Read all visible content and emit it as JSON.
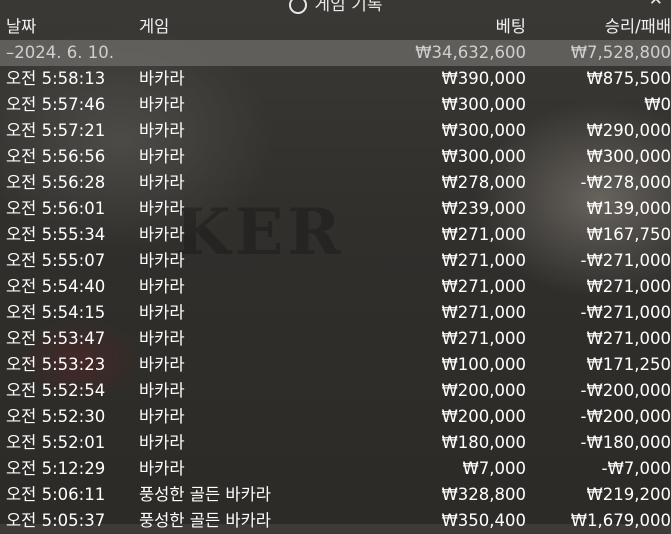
{
  "title": "게임 기록",
  "header": {
    "date": "날짜",
    "game": "게임",
    "bet": "베팅",
    "result": "승리/패배"
  },
  "summary": {
    "date": "–2024. 6. 10.",
    "game": "",
    "bet": "₩34,632,600",
    "result": "₩7,528,800"
  },
  "rows": [
    {
      "date": "오전 5:58:13",
      "game": "바카라",
      "bet": "₩390,000",
      "result": "₩875,500"
    },
    {
      "date": "오전 5:57:46",
      "game": "바카라",
      "bet": "₩300,000",
      "result": "₩0"
    },
    {
      "date": "오전 5:57:21",
      "game": "바카라",
      "bet": "₩300,000",
      "result": "₩290,000"
    },
    {
      "date": "오전 5:56:56",
      "game": "바카라",
      "bet": "₩300,000",
      "result": "₩300,000"
    },
    {
      "date": "오전 5:56:28",
      "game": "바카라",
      "bet": "₩278,000",
      "result": "-₩278,000"
    },
    {
      "date": "오전 5:56:01",
      "game": "바카라",
      "bet": "₩239,000",
      "result": "₩139,000"
    },
    {
      "date": "오전 5:55:34",
      "game": "바카라",
      "bet": "₩271,000",
      "result": "₩167,750"
    },
    {
      "date": "오전 5:55:07",
      "game": "바카라",
      "bet": "₩271,000",
      "result": "-₩271,000"
    },
    {
      "date": "오전 5:54:40",
      "game": "바카라",
      "bet": "₩271,000",
      "result": "₩271,000"
    },
    {
      "date": "오전 5:54:15",
      "game": "바카라",
      "bet": "₩271,000",
      "result": "-₩271,000"
    },
    {
      "date": "오전 5:53:47",
      "game": "바카라",
      "bet": "₩271,000",
      "result": "₩271,000"
    },
    {
      "date": "오전 5:53:23",
      "game": "바카라",
      "bet": "₩100,000",
      "result": "₩171,250"
    },
    {
      "date": "오전 5:52:54",
      "game": "바카라",
      "bet": "₩200,000",
      "result": "-₩200,000"
    },
    {
      "date": "오전 5:52:30",
      "game": "바카라",
      "bet": "₩200,000",
      "result": "-₩200,000"
    },
    {
      "date": "오전 5:52:01",
      "game": "바카라",
      "bet": "₩180,000",
      "result": "-₩180,000"
    },
    {
      "date": "오전 5:12:29",
      "game": "바카라",
      "bet": "₩7,000",
      "result": "-₩7,000"
    },
    {
      "date": "오전 5:06:11",
      "game": "풍성한 골든 바카라",
      "bet": "₩328,800",
      "result": "₩219,200"
    },
    {
      "date": "오전 5:05:37",
      "game": "풍성한 골든 바카라",
      "bet": "₩350,400",
      "result": "₩1,679,000"
    }
  ]
}
